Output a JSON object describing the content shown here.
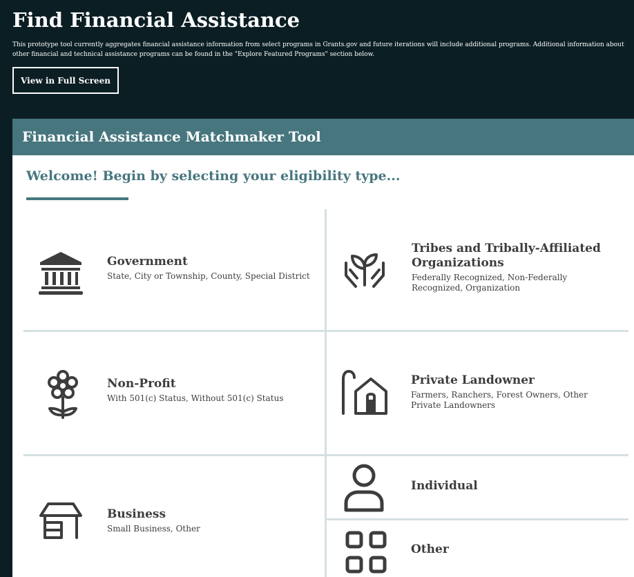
{
  "page": {
    "title": "Find Financial Assistance",
    "intro": "This prototype tool currently aggregates financial assistance information from select programs in Grants.gov and future iterations will include additional programs. Additional information about other financial and technical assistance programs can be found in the \"Explore Featured Programs\" section below.",
    "fullscreen_label": "View in Full Screen"
  },
  "tool": {
    "header": "Financial Assistance Matchmaker Tool",
    "welcome": "Welcome! Begin by selecting your eligibility type..."
  },
  "cards": {
    "government": {
      "title": "Government",
      "subtitle": "State, City or Township, County, Special District",
      "icon": "government-building-icon"
    },
    "tribes": {
      "title": "Tribes and Tribally-Affiliated Organizations",
      "subtitle": "Federally Recognized, Non-Federally Recognized, Organization",
      "icon": "hands-plant-icon"
    },
    "nonprofit": {
      "title": "Non-Profit",
      "subtitle": "With 501(c) Status, Without 501(c) Status",
      "icon": "flower-icon"
    },
    "landowner": {
      "title": "Private Landowner",
      "subtitle": "Farmers, Ranchers, Forest Owners, Other Private Landowners",
      "icon": "house-lock-icon"
    },
    "business": {
      "title": "Business",
      "subtitle": "Small Business, Other",
      "icon": "storefront-icon"
    },
    "individual": {
      "title": "Individual",
      "icon": "person-icon"
    },
    "other": {
      "title": "Other",
      "icon": "grid-icon"
    }
  },
  "colors": {
    "dark_bg": "#0b1e24",
    "accent": "#47767f",
    "divider": "#d5e0e3",
    "text": "#3d3d3d"
  }
}
